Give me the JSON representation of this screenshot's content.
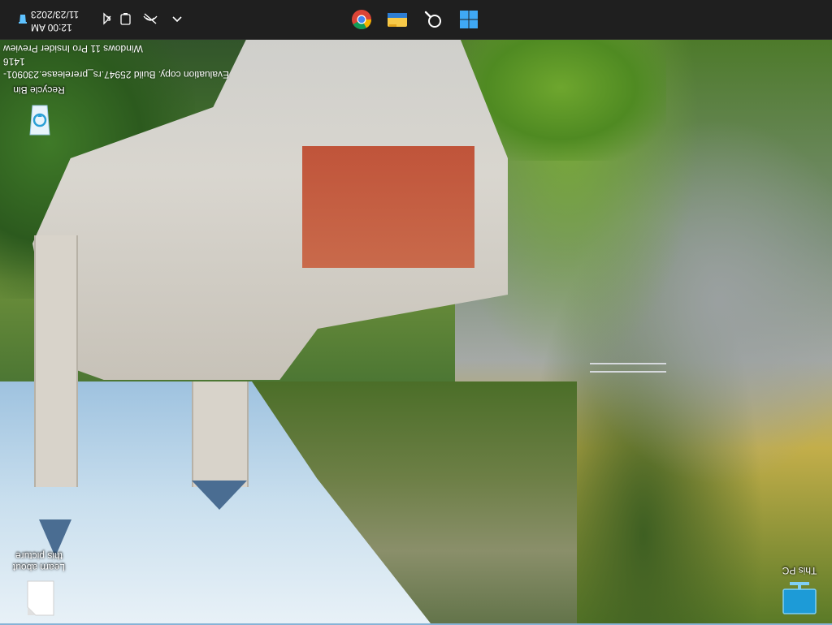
{
  "taskbar": {
    "pinned": [
      {
        "name": "chrome-icon",
        "label": "Google Chrome"
      },
      {
        "name": "file-explorer-icon",
        "label": "File Explorer"
      },
      {
        "name": "search-icon",
        "label": "Search"
      },
      {
        "name": "start-icon",
        "label": "Start"
      }
    ],
    "tray": {
      "time": "12:00 AM",
      "date": "11/23/2023",
      "icons": [
        "recycle-tray-icon",
        "speaker-muted-icon",
        "battery-icon",
        "network-disconnected-icon",
        "chevron-up-icon"
      ]
    }
  },
  "watermark": {
    "line1": "Windows 11 Pro Insider Preview",
    "line2": "Evaluation copy. Build 25947.rs_prerelease.230901-1416"
  },
  "desktop": {
    "icons": [
      {
        "name": "recycle-bin-icon",
        "label": "Recycle Bin"
      },
      {
        "name": "learn-about-picture-icon",
        "label": "Learn about this picture"
      },
      {
        "name": "this-pc-icon",
        "label": "This PC"
      }
    ]
  },
  "colors": {
    "taskbar_bg": "#1f1f1f",
    "accent": "#0078d4",
    "start_blue": "#3fa9f5"
  }
}
